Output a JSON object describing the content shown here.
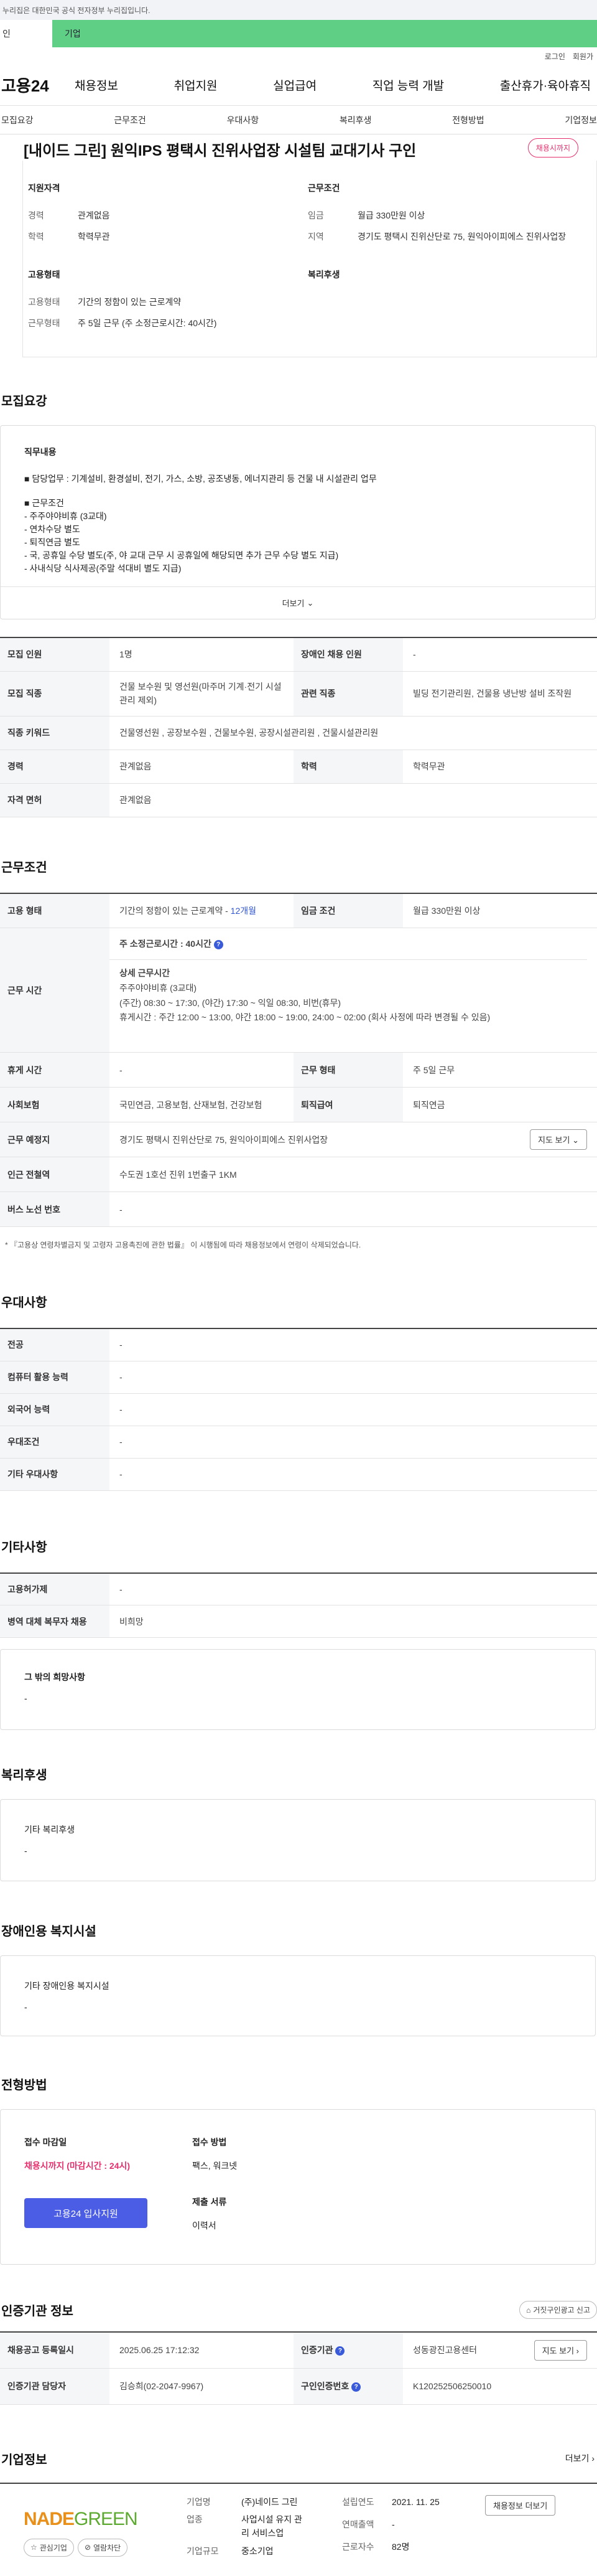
{
  "gov_bar": {
    "text": "누리집은 대한민국 공식 전자정부 누리집입니다."
  },
  "user_tabs": [
    {
      "label": "인"
    },
    {
      "label": "기업"
    }
  ],
  "util": {
    "login": "로그인",
    "join": "회원가"
  },
  "gnb": {
    "logo": "고용24",
    "menu": [
      "채용정보",
      "취업지원",
      "실업급여",
      "직업 능력 개발",
      "출산휴가·육아휴직"
    ]
  },
  "anchors": [
    "모집요강",
    "근무조건",
    "우대사항",
    "복리후생",
    "전형방법",
    "기업정보"
  ],
  "job": {
    "title": "[내이드 그린] 원익IPS 평택시 진위사업장 시설팀 교대기사 구인",
    "status": "채용시까지"
  },
  "summary": {
    "qual_title": "지원자격",
    "qual": [
      {
        "k": "경력",
        "v": "관계없음"
      },
      {
        "k": "학력",
        "v": "학력무관"
      }
    ],
    "cond_title": "근무조건",
    "cond": [
      {
        "k": "임금",
        "v": "월급 330만원 이상"
      },
      {
        "k": "지역",
        "v": "경기도 평택시 진위산단로 75, 원익아이피에스 진위사업장"
      }
    ],
    "emp_title": "고용형태",
    "emp": [
      {
        "k": "고용형태",
        "v": "기간의 정함이 있는 근로계약"
      },
      {
        "k": "근무형태",
        "v": "주 5일 근무 (주 소정근로시간: 40시간)"
      }
    ],
    "welfare_title": "복리후생"
  },
  "recruit": {
    "title": "모집요강",
    "duty_title": "직무내용",
    "duty_main": "■ 담당업무 : 기계설비, 환경설비, 전기, 가스, 소방, 공조냉동, 에너지관리 등 건물 내 시설관리 업무",
    "duty_cond": [
      "■ 근무조건",
      "- 주주야야비휴 (3교대)",
      "- 연차수당 별도",
      "- 퇴직연금 별도",
      "- 국, 공휴일 수당 별도(주, 야 교대 근무 시 공휴일에 해당되면 추가 근무 수당 별도 지급)",
      "- 사내식당 식사제공(주말 석대비 별도 지급)"
    ],
    "more": "더보기",
    "rows": [
      {
        "k1": "모집 인원",
        "v1": "1명",
        "k2": "장애인 채용 인원",
        "v2": "-"
      },
      {
        "k1": "모집 직종",
        "v1": "건물 보수원 및 영선원(마주머 기계·전기 시설관리 제외)",
        "k2": "관련 직종",
        "v2": "빌딩 전기관리원, 건물용 냉난방 설비 조작원"
      },
      {
        "k1": "직종 키워드",
        "v1": "건물영선원 , 공장보수원 , 건물보수원, 공장시설관리원 , 건물시설관리원"
      },
      {
        "k1": "경력",
        "v1": "관계없음",
        "k2": "학력",
        "v2": "학력무관"
      },
      {
        "k1": "자격 면허",
        "v1": "관계없음"
      }
    ]
  },
  "work": {
    "title": "근무조건",
    "emp_k": "고용 형태",
    "emp_v": "기간의 정함이 있는 근로계약 - ",
    "emp_months": "12개월",
    "wage_k": "임금 조건",
    "wage_v": "월급 330만원 이상",
    "time_k": "근무 시간",
    "weekly": "주 소정근로시간 : 40시간",
    "detail_title": "상세 근무시간",
    "detail": [
      "주주야야비휴 (3교대)",
      "(주간) 08:30 ~ 17:30, (야간) 17:30 ~ 익일 08:30, 비번(휴무)",
      "휴게시간 : 주간 12:00 ~ 13:00, 야간 18:00 ~ 19:00, 24:00 ~ 02:00 (회사 사정에 따라 변경될 수 있음)"
    ],
    "holiday_k": "휴게 시간",
    "holiday_v": "-",
    "form_k": "근무 형태",
    "form_v": "주 5일 근무",
    "ins_k": "사회보험",
    "ins_v": "국민연금, 고용보험, 산재보험, 건강보험",
    "ret_k": "퇴직급여",
    "ret_v": "퇴직연금",
    "loc_k": "근무 예정지",
    "loc_v": "경기도 평택시 진위산단로 75, 원익아이피에스 진위사업장",
    "map": "지도 보기",
    "sub_k": "인근 전철역",
    "sub_v": "수도권 1호선 진위 1번출구 1KM",
    "bus_k": "버스 노선 번호",
    "bus_v": "-",
    "note": "* 『고용상 연령차별금지 및 고령자 고용촉진에 관한 법률』 이 시행됨에 따라 채용정보에서 연령이 삭제되었습니다."
  },
  "pref": {
    "title": "우대사항",
    "rows": [
      {
        "k": "전공",
        "v": "-"
      },
      {
        "k": "컴퓨터 활용 능력",
        "v": "-"
      },
      {
        "k": "외국어 능력",
        "v": "-"
      },
      {
        "k": "우대조건",
        "v": "-"
      },
      {
        "k": "기타 우대사항",
        "v": "-"
      }
    ]
  },
  "etc": {
    "title": "기타사항",
    "rows": [
      {
        "k": "고용허가제",
        "v": "-"
      },
      {
        "k": "병역 대체 복무자 채용",
        "v": "비희망"
      }
    ],
    "other_title": "그 밖의 희망사항",
    "other_v": "-"
  },
  "welfare": {
    "title": "복리후생",
    "box_title": "기타 복리후생",
    "box_v": "-"
  },
  "disabled": {
    "title": "장애인용 복지시설",
    "box_title": "기타 장애인용 복지시설",
    "box_v": "-"
  },
  "process": {
    "title": "전형방법",
    "deadline_title": "접수 마감일",
    "deadline_v": "채용시까지 (마감시간 : 24시)",
    "apply": "고용24 입사지원",
    "method_title": "접수 방법",
    "method_v": "팩스, 워크넷",
    "docs_title": "제출 서류",
    "docs_v": "이력서"
  },
  "cert": {
    "title": "인증기관 정보",
    "report": "거짓구인광고 신고",
    "reg_k": "채용공고 등록일시",
    "reg_v": "2025.06.25 17:12:32",
    "org_k": "인증기관",
    "org_v": "성동광진고용센터",
    "map": "지도 보기",
    "mgr_k": "인증기관 담당자",
    "mgr_v": "김승희(02-2047-9967)",
    "no_k": "구인인증번호",
    "no_v": "K120252506250010"
  },
  "company": {
    "title": "기업정보",
    "more": "더보기",
    "logo_a": "NADE",
    "logo_b": "GREEN",
    "fav": "관심기업",
    "block": "열람차단",
    "fields": [
      {
        "k": "기업명",
        "v": "(주)네이드 그린"
      },
      {
        "k": "업종",
        "v": "사업시설 유지 관리 서비스업"
      },
      {
        "k": "기업규모",
        "v": "중소기업"
      }
    ],
    "fields2": [
      {
        "k": "설립연도",
        "v": "2021. 11. 25"
      },
      {
        "k": "연매출액",
        "v": "-"
      },
      {
        "k": "근로자수",
        "v": "82명"
      }
    ],
    "list_btn": "채용정보 더보기"
  },
  "colors": {
    "brand_green": "#5fcf85",
    "accent_blue": "#4b5de4",
    "closed_pink": "#e5306e"
  }
}
